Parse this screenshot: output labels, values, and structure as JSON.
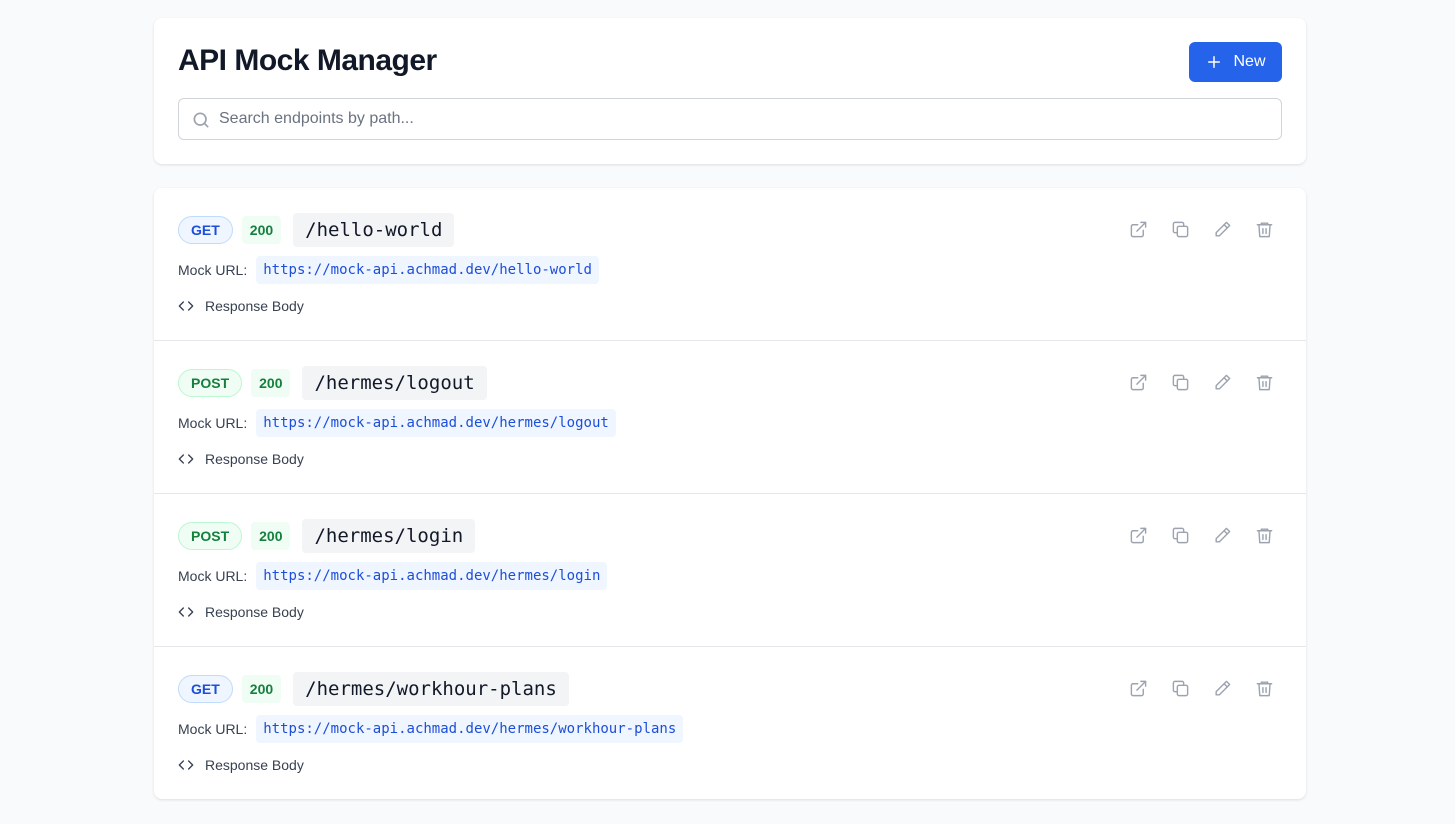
{
  "header": {
    "title": "API Mock Manager",
    "new_label": "New"
  },
  "search": {
    "placeholder": "Search endpoints by path...",
    "value": ""
  },
  "colors": {
    "primary": "#2563eb",
    "get": "#1d4ed8",
    "post": "#15803d",
    "status_ok": "#15803d"
  },
  "endpoints": [
    {
      "method": "GET",
      "status": "200",
      "path": "/hello-world",
      "mock_label": "Mock URL:",
      "mock_url": "https://mock-api.achmad.dev/hello-world",
      "body_label": "Response Body"
    },
    {
      "method": "POST",
      "status": "200",
      "path": "/hermes/logout",
      "mock_label": "Mock URL:",
      "mock_url": "https://mock-api.achmad.dev/hermes/logout",
      "body_label": "Response Body"
    },
    {
      "method": "POST",
      "status": "200",
      "path": "/hermes/login",
      "mock_label": "Mock URL:",
      "mock_url": "https://mock-api.achmad.dev/hermes/login",
      "body_label": "Response Body"
    },
    {
      "method": "GET",
      "status": "200",
      "path": "/hermes/workhour-plans",
      "mock_label": "Mock URL:",
      "mock_url": "https://mock-api.achmad.dev/hermes/workhour-plans",
      "body_label": "Response Body"
    }
  ],
  "row_actions": [
    "external-link-icon",
    "copy-icon",
    "edit-icon",
    "trash-icon"
  ]
}
